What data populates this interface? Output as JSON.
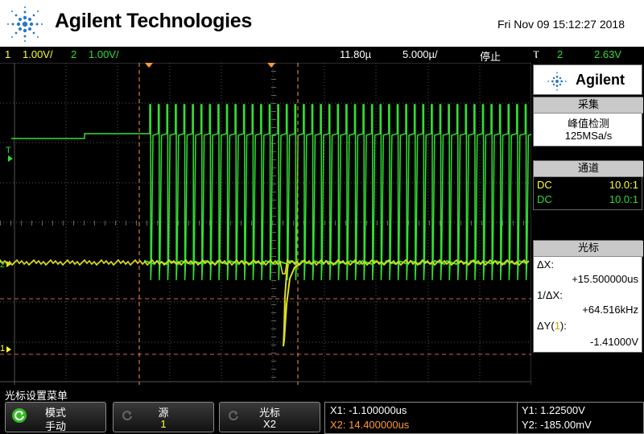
{
  "header": {
    "brand": "Agilent Technologies",
    "datetime": "Fri Nov 09 15:12:27 2018"
  },
  "status": {
    "ch1_num": "1",
    "ch1_scale": "1.00V/",
    "ch2_num": "2",
    "ch2_scale": "1.00V/",
    "time_delay": "11.80µ",
    "time_scale": "5.000µ/",
    "run_state": "停止",
    "trigger_symbol": "Ⲧ",
    "trigger_source": "2",
    "trigger_level": "2.63V"
  },
  "panel": {
    "brand": "Agilent",
    "acquire_title": "采集",
    "acquire_mode": "峰值检测",
    "sample_rate": "125MSa/s",
    "channel_title": "通道",
    "ch1_coupling": "DC",
    "ch1_probe": "10.0:1",
    "ch2_coupling": "DC",
    "ch2_probe": "10.0:1",
    "cursor_title": "光标",
    "dx_label": "ΔX:",
    "dx_value": "+15.500000us",
    "inv_dx_label": "1/ΔX:",
    "inv_dx_value": "+64.516kHz",
    "dy_label_pre": "ΔY(",
    "dy_label_ch": "1",
    "dy_label_post": "):",
    "dy_value": "-1.41000V"
  },
  "scope": {
    "ch1_marker": "2",
    "trig_marker": "T",
    "gnd1_marker": "1"
  },
  "menu": {
    "title": "光标设置菜单",
    "key1_label": "模式",
    "key1_value": "手动",
    "key2_label": "源",
    "key2_value": "1",
    "key3_label": "光标",
    "key3_value": "X2"
  },
  "readout": {
    "x1": "X1: -1.100000us",
    "x2": "X2: 14.400000us",
    "y1": "Y1: 1.22500V",
    "y2": "Y2: -185.00mV"
  },
  "colors": {
    "ch1": "#ffff33",
    "ch2": "#33dd33",
    "cursor_x": "#ff9933",
    "cursor_y": "#ff9933",
    "grid": "#555555",
    "accent_blue": "#2a6fb0"
  }
}
